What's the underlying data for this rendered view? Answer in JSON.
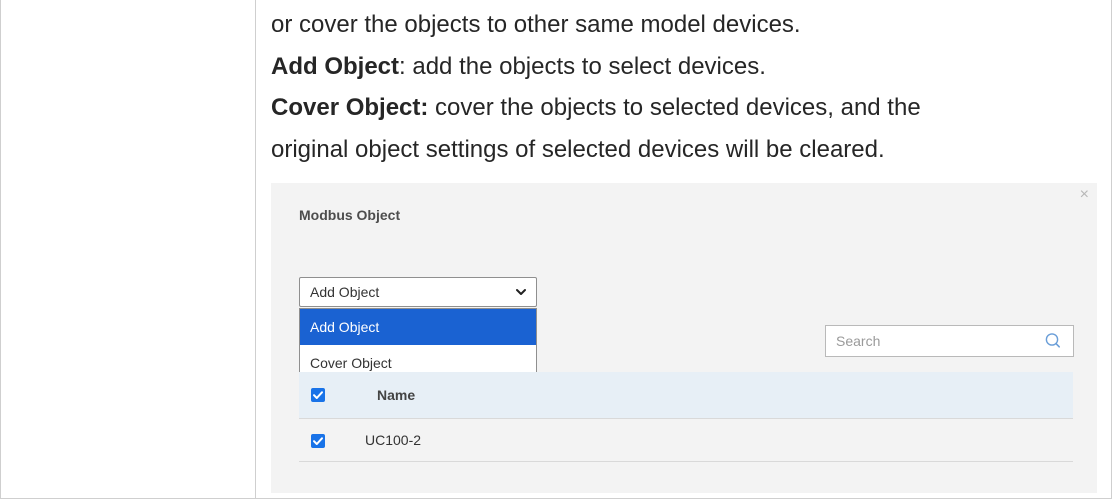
{
  "document": {
    "lines": [
      {
        "bold": "",
        "text": "or cover the objects to other same model devices."
      },
      {
        "bold": "Add Object",
        "text": ": add the objects to select devices."
      },
      {
        "bold": "Cover Object:",
        "text": " cover the objects to selected devices, and the"
      },
      {
        "bold": "",
        "text": "original object settings of selected devices will be cleared."
      }
    ]
  },
  "dialog": {
    "title": "Modbus Object",
    "close_icon": "close-icon",
    "select": {
      "value": "Add Object",
      "options": [
        "Add Object",
        "Cover Object"
      ],
      "selected_index": 0
    },
    "search": {
      "placeholder": "Search",
      "icon": "search-icon"
    },
    "table": {
      "header": {
        "name": "Name",
        "checked": true
      },
      "rows": [
        {
          "name": "UC100-2",
          "checked": true
        }
      ]
    },
    "colors": {
      "accent": "#1a62d2",
      "checkbox": "#1973e8",
      "header_bg": "#e7eff6",
      "dialog_bg": "#f3f3f3"
    }
  }
}
